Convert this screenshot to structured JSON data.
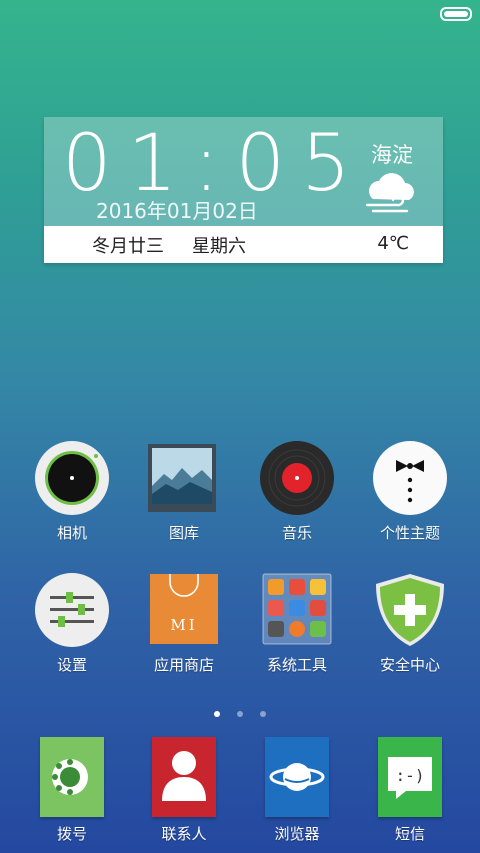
{
  "status_bar": {
    "battery_level": 1.0
  },
  "widget": {
    "time": "01:05",
    "date": "2016年01月02日",
    "location": "海淀",
    "weather_icon": "cloud-wind-icon",
    "lunar_date": "冬月廿三",
    "weekday": "星期六",
    "temperature": "4℃"
  },
  "apps": [
    {
      "label": "相机",
      "icon": "camera-icon"
    },
    {
      "label": "图库",
      "icon": "gallery-icon"
    },
    {
      "label": "音乐",
      "icon": "music-icon"
    },
    {
      "label": "个性主题",
      "icon": "themes-icon"
    },
    {
      "label": "设置",
      "icon": "settings-icon"
    },
    {
      "label": "应用商店",
      "icon": "app-store-icon",
      "icon_text": "MI"
    },
    {
      "label": "系统工具",
      "icon": "system-tools-folder-icon"
    },
    {
      "label": "安全中心",
      "icon": "security-center-icon"
    }
  ],
  "pager": {
    "count": 3,
    "active": 0
  },
  "dock": [
    {
      "label": "拨号",
      "icon": "dialer-icon",
      "color": "#7cc361"
    },
    {
      "label": "联系人",
      "icon": "contacts-icon",
      "color": "#c8252e"
    },
    {
      "label": "浏览器",
      "icon": "browser-icon",
      "color": "#1e6fc0"
    },
    {
      "label": "短信",
      "icon": "messages-icon",
      "color": "#3ab54a",
      "icon_text": ":-)"
    }
  ]
}
